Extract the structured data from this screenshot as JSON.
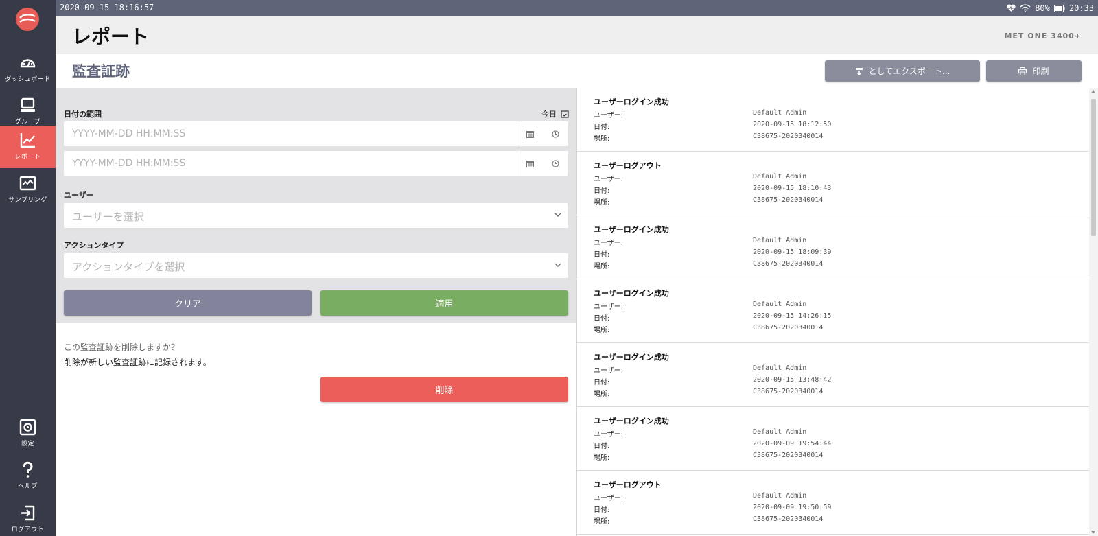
{
  "statusbar": {
    "datetime": "2020-09-15 18:16:57",
    "battery": "80%",
    "clock": "20:33"
  },
  "sidebar": {
    "items": [
      {
        "label": "ダッシュボード",
        "icon": "dashboard-gauge-icon"
      },
      {
        "label": "グループ",
        "icon": "group-icon"
      },
      {
        "label": "レポート",
        "icon": "report-chart-icon"
      },
      {
        "label": "サンプリング",
        "icon": "sampling-icon"
      },
      {
        "label": "設定",
        "icon": "settings-gear-icon"
      },
      {
        "label": "ヘルプ",
        "icon": "help-icon"
      },
      {
        "label": "ログアウト",
        "icon": "logout-icon"
      }
    ]
  },
  "header": {
    "title": "レポート",
    "device": "MET ONE 3400+"
  },
  "subheader": {
    "title": "監査証跡",
    "export_label": "としてエクスポート...",
    "print_label": "印刷"
  },
  "filters": {
    "date_range_label": "日付の範囲",
    "today_label": "今日",
    "start_placeholder": "YYYY-MM-DD HH:MM:SS",
    "end_placeholder": "YYYY-MM-DD HH:MM:SS",
    "user_label": "ユーザー",
    "user_placeholder": "ユーザーを選択",
    "action_label": "アクションタイプ",
    "action_placeholder": "アクションタイプを選択",
    "clear_label": "クリア",
    "apply_label": "適用"
  },
  "delete": {
    "question": "この監査証跡を削除しますか？",
    "info": "削除が新しい監査証跡に記録されます。",
    "button_label": "削除"
  },
  "log": {
    "key_user": "ユーザー:",
    "key_date": "日付:",
    "key_location": "場所:",
    "entries": [
      {
        "title": "ユーザーログイン成功",
        "user": "Default Admin",
        "date": "2020-09-15 18:12:50",
        "location": "C38675-2020340014"
      },
      {
        "title": "ユーザーログアウト",
        "user": "Default Admin",
        "date": "2020-09-15 18:10:43",
        "location": "C38675-2020340014"
      },
      {
        "title": "ユーザーログイン成功",
        "user": "Default Admin",
        "date": "2020-09-15 18:09:39",
        "location": "C38675-2020340014"
      },
      {
        "title": "ユーザーログイン成功",
        "user": "Default Admin",
        "date": "2020-09-15 14:26:15",
        "location": "C38675-2020340014"
      },
      {
        "title": "ユーザーログイン成功",
        "user": "Default Admin",
        "date": "2020-09-15 13:48:42",
        "location": "C38675-2020340014"
      },
      {
        "title": "ユーザーログイン成功",
        "user": "Default Admin",
        "date": "2020-09-09 19:54:44",
        "location": "C38675-2020340014"
      },
      {
        "title": "ユーザーログアウト",
        "user": "Default Admin",
        "date": "2020-09-09 19:50:59",
        "location": "C38675-2020340014"
      }
    ]
  },
  "colors": {
    "sidebar": "#373b47",
    "active": "#eb5e5a",
    "apply": "#79ad62",
    "clear": "#81849a",
    "statusbar": "#5f6479"
  }
}
